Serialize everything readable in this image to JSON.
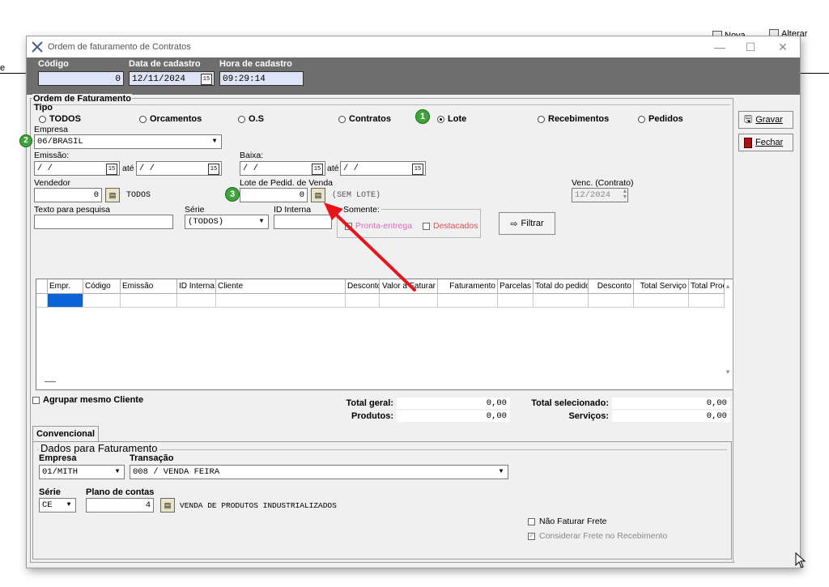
{
  "background_app": {
    "nova_label": "Nova",
    "alterar_label": "Alterar",
    "left_fragment": "e"
  },
  "window": {
    "title": "Ordem de faturamento de Contratos",
    "controls": {
      "minimize": "—",
      "maximize": "☐",
      "close": "✕"
    }
  },
  "header": {
    "codigo_label": "Código",
    "codigo_value": "0",
    "data_label": "Data de cadastro",
    "data_value": "12/11/2024",
    "hora_label": "Hora de cadastro",
    "hora_value": "09:29:14"
  },
  "ordem": {
    "section_title": "Ordem de Faturamento",
    "tipo_label": "Tipo",
    "tipo_options": [
      "TODOS",
      "Orcamentos",
      "O.S",
      "Contratos",
      "Lote",
      "Recebimentos",
      "Pedidos"
    ],
    "tipo_selected": "Lote",
    "empresa_label": "Empresa",
    "empresa_value": "06/BRASIL",
    "emissao_label": "Emissão:",
    "emissao_de": " /  /",
    "emissao_ate_label": "até",
    "emissao_ate": " /  /",
    "baixa_label": "Baixa:",
    "baixa_de": " /  /",
    "baixa_ate_label": "até",
    "baixa_ate": " /  /",
    "vendedor_label": "Vendedor",
    "vendedor_value": "0",
    "vendedor_name": "TODOS",
    "lote_label": "Lote de Pedid. de Venda",
    "lote_value": "0",
    "lote_name": "(SEM LOTE)",
    "venc_label": "Venc. (Contrato)",
    "venc_value": "12/2024",
    "texto_label": "Texto para pesquisa",
    "texto_value": "",
    "serie_label": "Série",
    "serie_value": "(TODOS)",
    "id_interna_label": "ID Interna",
    "id_interna_value": "",
    "somente_label": "Somente:",
    "pronta_entrega_label": "Pronta-entrega",
    "destacados_label": "Destacados",
    "filtrar_label": "Filtrar"
  },
  "grid": {
    "columns": [
      "Empr.",
      "Código",
      "Emissão",
      "ID Interna",
      "Cliente",
      "Desconto",
      "Valor a Faturar",
      "Faturamento",
      "Parcelas",
      "Total do pedido",
      "Desconto",
      "Total Serviço",
      "Total Proc"
    ]
  },
  "totals": {
    "agrupar_label": "Agrupar mesmo Cliente",
    "total_geral_label": "Total geral:",
    "total_geral_value": "0,00",
    "produtos_label": "Produtos:",
    "produtos_value": "0,00",
    "total_sel_label": "Total selecionado:",
    "total_sel_value": "0,00",
    "servicos_label": "Serviços:",
    "servicos_value": "0,00"
  },
  "convencional": {
    "tab_label": "Convencional",
    "section_title": "Dados para Faturamento",
    "empresa_label": "Empresa",
    "empresa_value": "01/MITH",
    "transacao_label": "Transação",
    "transacao_value": "008 / VENDA FEIRA",
    "serie_label": "Série",
    "serie_value": "CE",
    "plano_label": "Plano de contas",
    "plano_value": "4",
    "plano_name": "VENDA DE PRODUTOS INDUSTRIALIZADOS",
    "nao_faturar_frete": "Não Faturar Frete",
    "considerar_frete": "Considerar Frete no Recebimento"
  },
  "side_buttons": {
    "gravar": "Gravar",
    "fechar": "Fechar"
  },
  "annotations": {
    "badge1": "1",
    "badge2": "2",
    "badge3": "3"
  },
  "colors": {
    "header_band": "#6e6e6e",
    "header_field": "#dce4f5",
    "badge": "#3fa43a",
    "arrow": "#e8141c",
    "grid_selected": "#0a64d8"
  }
}
